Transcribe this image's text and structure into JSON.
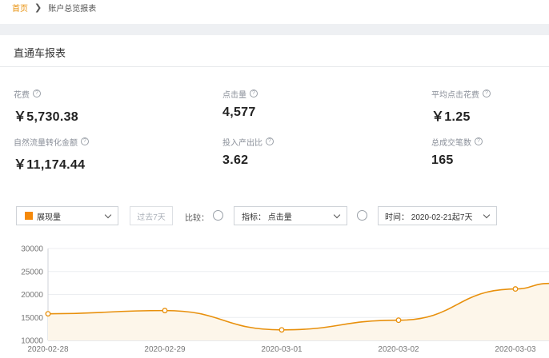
{
  "breadcrumb": {
    "home": "首页",
    "separator": "❯",
    "current": "账户总览报表"
  },
  "panel": {
    "title": "直通车报表"
  },
  "help_glyph": "?",
  "metrics": [
    {
      "label": "花费",
      "value": "￥5,730.38"
    },
    {
      "label": "点击量",
      "value": "4,577"
    },
    {
      "label": "平均点击花费",
      "value": "￥1.25"
    },
    {
      "label": "自然流量转化金额",
      "value": "￥11,174.44"
    },
    {
      "label": "投入产出比",
      "value": "3.62"
    },
    {
      "label": "总成交笔数",
      "value": "165"
    }
  ],
  "controls": {
    "metric_select": "展现量",
    "metric_color": "#f5890a",
    "past_range": "过去7天",
    "compare_label": "比较：",
    "index_select": "指标： 点击量",
    "time_select": "时间： 2020-02-21起7天"
  },
  "chart_data": {
    "type": "area",
    "x": [
      "2020-02-28",
      "2020-02-29",
      "2020-03-01",
      "2020-03-02",
      "2020-03-03"
    ],
    "series": [
      {
        "values": [
          15800,
          16500,
          12300,
          14400,
          21200
        ],
        "color": "#e8900c"
      }
    ],
    "continues_right_value": 22400,
    "ylim": [
      10000,
      30000
    ],
    "yticks": [
      10000,
      15000,
      20000,
      25000,
      30000
    ],
    "grid": true,
    "legend": "none",
    "title": "",
    "xlabel": "",
    "ylabel": ""
  }
}
